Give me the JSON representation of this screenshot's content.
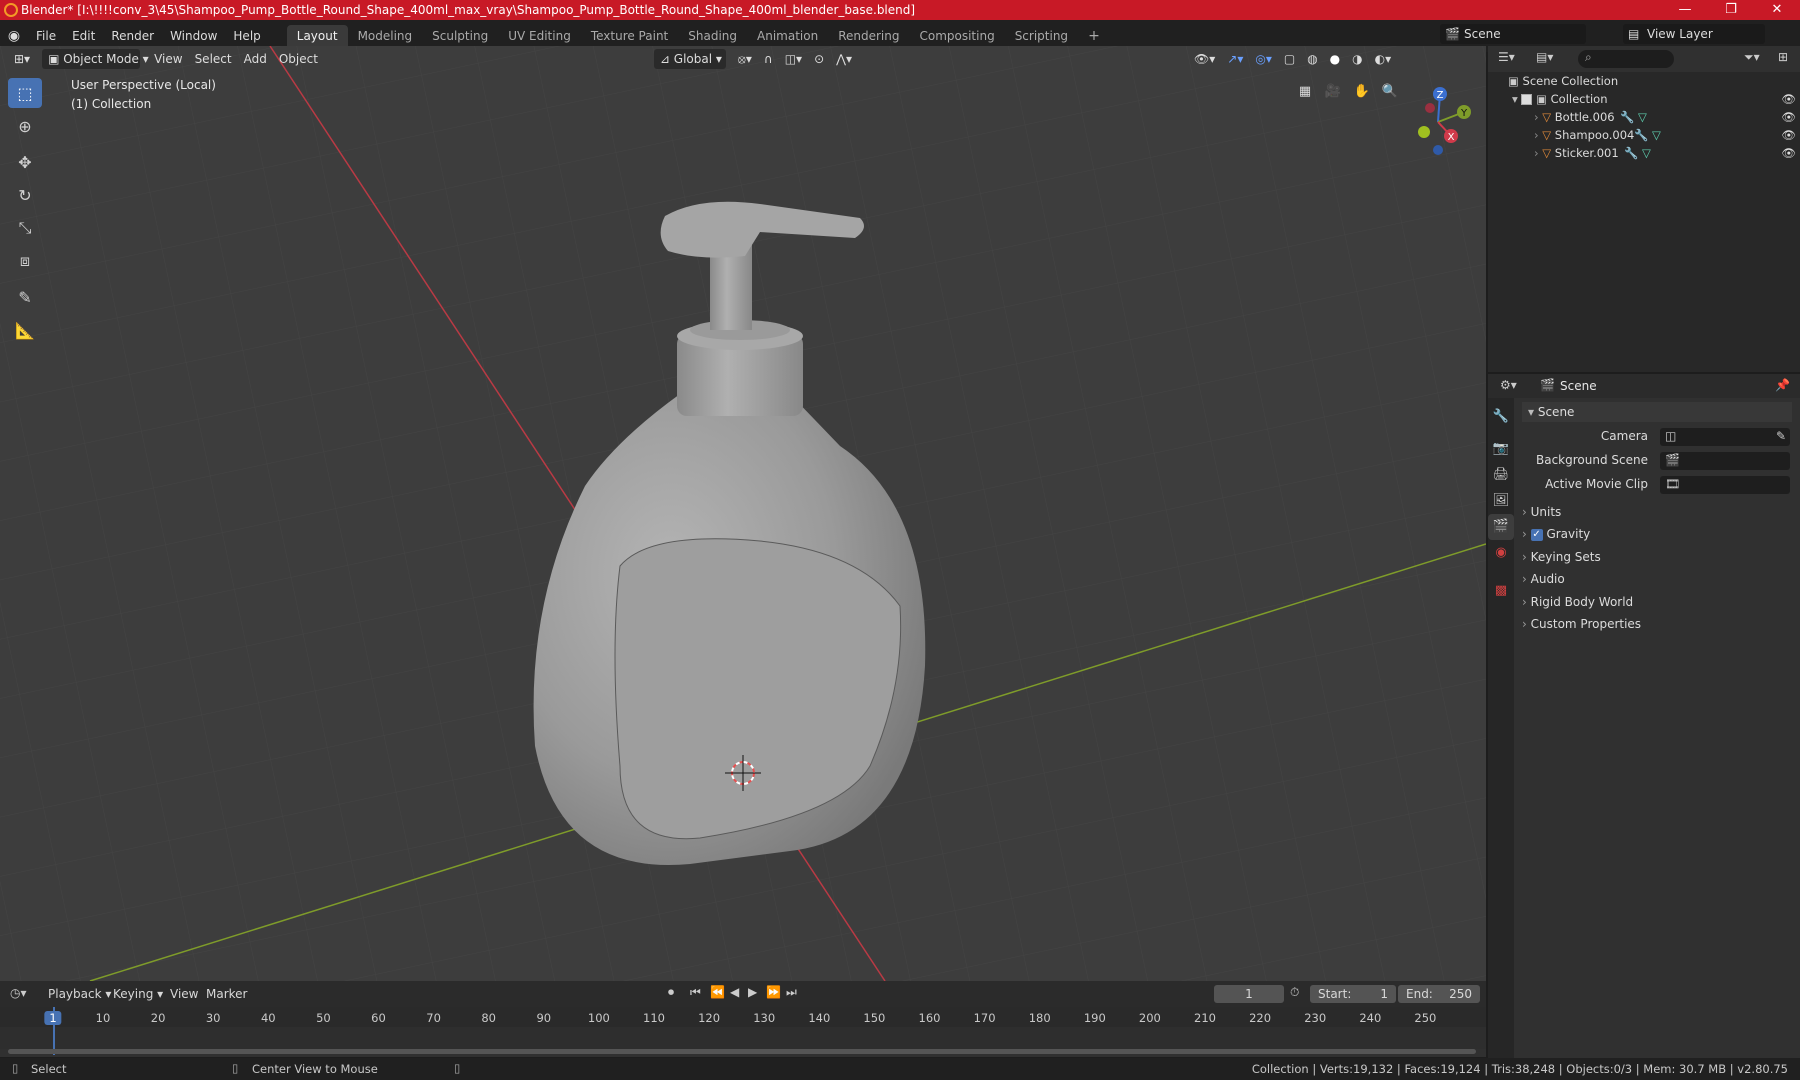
{
  "window": {
    "title": "Blender* [I:\\!!!!conv_3\\45\\Shampoo_Pump_Bottle_Round_Shape_400ml_max_vray\\Shampoo_Pump_Bottle_Round_Shape_400ml_blender_base.blend]",
    "min": "—",
    "max": "❐",
    "close": "✕"
  },
  "menu": [
    "File",
    "Edit",
    "Render",
    "Window",
    "Help"
  ],
  "workspaces": [
    "Layout",
    "Modeling",
    "Sculpting",
    "UV Editing",
    "Texture Paint",
    "Shading",
    "Animation",
    "Rendering",
    "Compositing",
    "Scripting"
  ],
  "workspace_add": "+",
  "scene_name": "Scene",
  "view_layer": "View Layer",
  "viewport": {
    "mode": "Object Mode",
    "view": "View",
    "select": "Select",
    "add": "Add",
    "object": "Object",
    "orientation": "Global",
    "info_line1": "User Perspective (Local)",
    "info_line2": "(1) Collection"
  },
  "gizmo": {
    "x": "X",
    "y": "Y",
    "z": "Z"
  },
  "outliner": {
    "scene_collection": "Scene Collection",
    "collection": "Collection",
    "items": [
      "Bottle.006",
      "Shampoo.004",
      "Sticker.001"
    ]
  },
  "properties": {
    "context": "Scene",
    "panel": "Scene",
    "camera_label": "Camera",
    "background_label": "Background Scene",
    "movie_clip_label": "Active Movie Clip",
    "sections": [
      "Units",
      "Gravity",
      "Keying Sets",
      "Audio",
      "Rigid Body World",
      "Custom Properties"
    ],
    "gravity_checked": true
  },
  "timeline": {
    "playback": "Playback",
    "keying": "Keying",
    "view": "View",
    "marker": "Marker",
    "current_frame": "1",
    "start_label": "Start:",
    "start": "1",
    "end_label": "End:",
    "end": "250",
    "ticks": [
      "1",
      "10",
      "20",
      "30",
      "40",
      "50",
      "60",
      "70",
      "80",
      "90",
      "100",
      "110",
      "120",
      "130",
      "140",
      "150",
      "160",
      "170",
      "180",
      "190",
      "200",
      "210",
      "220",
      "230",
      "240",
      "250"
    ]
  },
  "status": {
    "select": "Select",
    "center_view": "Center View to Mouse",
    "stats": "Collection | Verts:19,132 | Faces:19,124 | Tris:38,248 | Objects:0/3 | Mem: 30.7 MB | v2.80.75"
  },
  "colors": {
    "accent": "#4772b3",
    "title_red": "#c81926",
    "x_axis": "#b93a44",
    "y_axis": "#7f9c2a"
  }
}
